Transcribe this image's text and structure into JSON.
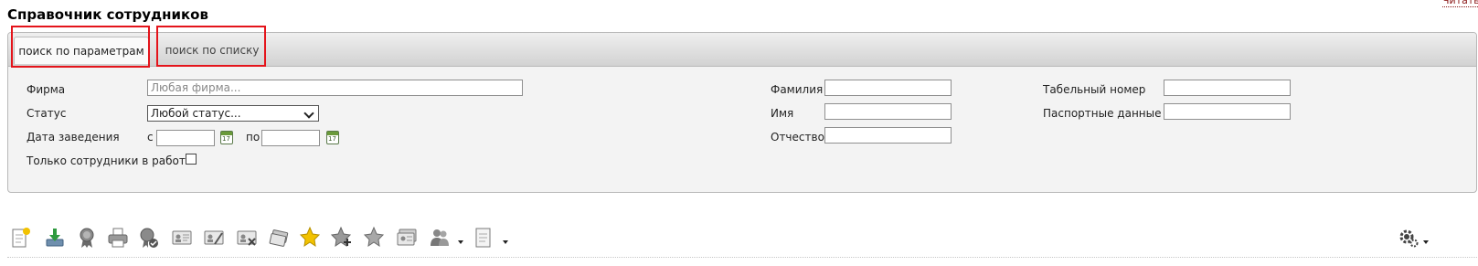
{
  "page": {
    "title": "Справочник сотрудников",
    "corner_link": "Читать"
  },
  "tabs": {
    "by_params": "поиск по параметрам",
    "by_list": "поиск по списку"
  },
  "form": {
    "firm": {
      "label": "Фирма",
      "placeholder": "Любая фирма..."
    },
    "status": {
      "label": "Статус",
      "selected": "Любой статус..."
    },
    "date": {
      "label": "Дата заведения",
      "from": "с",
      "to": "по"
    },
    "only_working": {
      "label": "Только сотрудники в работе"
    },
    "surname": {
      "label": "Фамилия"
    },
    "name": {
      "label": "Имя"
    },
    "patronymic": {
      "label": "Отчество"
    },
    "tab_number": {
      "label": "Табельный номер"
    },
    "passport": {
      "label": "Паспортные данные"
    }
  },
  "toolbar": {
    "icons": [
      "new-document-icon",
      "download-icon",
      "award-icon",
      "print-icon",
      "approve-award-icon",
      "id-card-icon",
      "id-card-edit-icon",
      "id-card-delete-icon",
      "cards-stack-icon",
      "star-icon",
      "star-add-icon",
      "star-remove-icon",
      "id-card-list-icon",
      "users-menu-icon",
      "document-menu-icon",
      "settings-gear-icon"
    ]
  },
  "colors": {
    "highlight": "#e4141b",
    "panel_bg": "#f3f3f3",
    "star_gold": "#f2c200"
  }
}
